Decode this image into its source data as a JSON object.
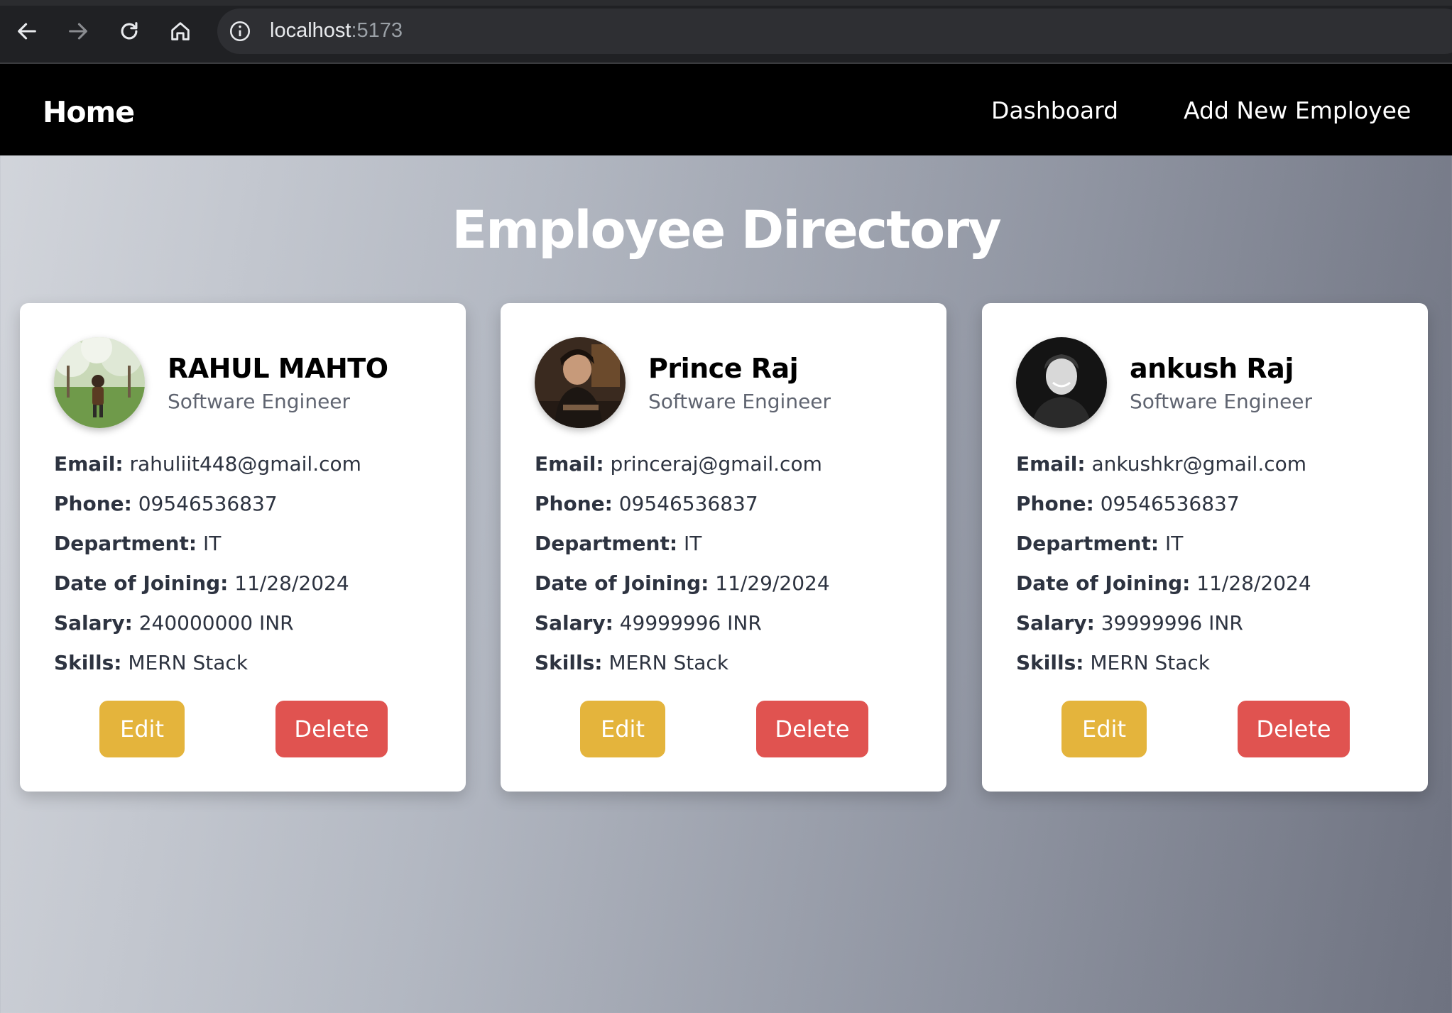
{
  "browser": {
    "url_host": "localhost",
    "url_port": ":5173"
  },
  "nav": {
    "home": "Home",
    "links": [
      "Dashboard",
      "Add New Employee"
    ]
  },
  "page": {
    "title": "Employee Directory"
  },
  "labels": {
    "email": "Email:",
    "phone": "Phone:",
    "department": "Department:",
    "date_of_joining": "Date of Joining:",
    "salary": "Salary:",
    "skills": "Skills:",
    "edit": "Edit",
    "delete": "Delete"
  },
  "employees": [
    {
      "name": "RAHUL MAHTO",
      "role": "Software Engineer",
      "email": "rahuliit448@gmail.com",
      "phone": "09546536837",
      "department": "IT",
      "date_of_joining": "11/28/2024",
      "salary": "240000000 INR",
      "skills": "MERN Stack"
    },
    {
      "name": "Prince Raj",
      "role": "Software Engineer",
      "email": "princeraj@gmail.com",
      "phone": "09546536837",
      "department": "IT",
      "date_of_joining": "11/29/2024",
      "salary": "49999996 INR",
      "skills": "MERN Stack"
    },
    {
      "name": "ankush Raj",
      "role": "Software Engineer",
      "email": "ankushkr@gmail.com",
      "phone": "09546536837",
      "department": "IT",
      "date_of_joining": "11/28/2024",
      "salary": "39999996 INR",
      "skills": "MERN Stack"
    }
  ],
  "colors": {
    "edit_button": "#e4b43c",
    "delete_button": "#e05350",
    "navbar": "#000000"
  }
}
